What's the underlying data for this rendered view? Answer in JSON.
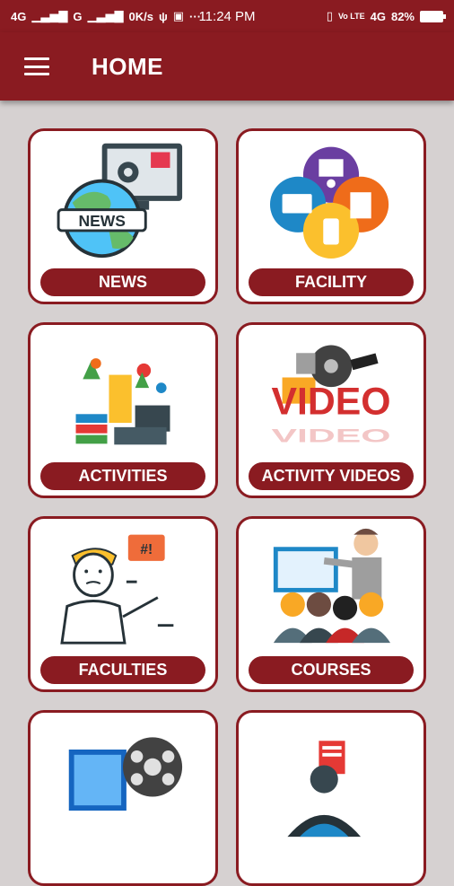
{
  "status_bar": {
    "network": "4G",
    "network2": "G",
    "speed": "0K/s",
    "dots": "···",
    "time": "11:24 PM",
    "volte": "Vo LTE",
    "network3": "4G",
    "battery": "82%"
  },
  "app_bar": {
    "title": "HOME"
  },
  "menu": [
    {
      "label": "NEWS",
      "icon": "news-globe-icon"
    },
    {
      "label": "FACILITY",
      "icon": "facility-icon"
    },
    {
      "label": "ACTIVITIES",
      "icon": "activities-icon"
    },
    {
      "label": "ACTIVITY VIDEOS",
      "icon": "video-reel-icon"
    },
    {
      "label": "FACULTIES",
      "icon": "faculty-teacher-icon"
    },
    {
      "label": "COURSES",
      "icon": "courses-classroom-icon"
    },
    {
      "label": "",
      "icon": "film-reel-icon"
    },
    {
      "label": "",
      "icon": "person-document-icon"
    }
  ],
  "colors": {
    "primary": "#8a1b21",
    "background": "#d6d1d1"
  }
}
